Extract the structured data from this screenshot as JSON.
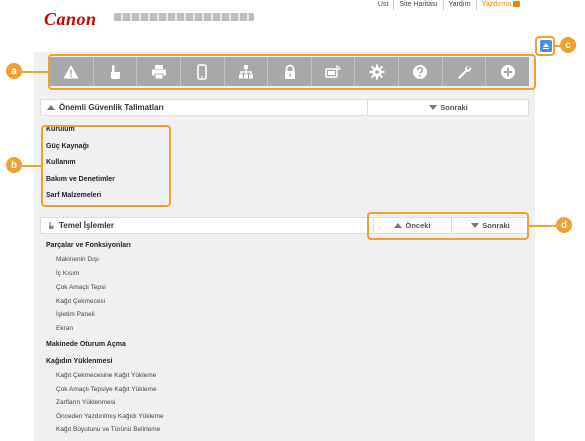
{
  "header": {
    "logo": "Canon",
    "links": [
      "Üst",
      "Site Haritası",
      "Yardım",
      "Yazdırma"
    ]
  },
  "toolbar": {
    "icons": [
      "warning-icon",
      "hand-icon",
      "printer-icon",
      "phone-icon",
      "network-icon",
      "lock-icon",
      "device-icon",
      "gear-icon",
      "help-icon",
      "wrench-icon",
      "plus-icon"
    ]
  },
  "section_safety": {
    "title": "Önemli Güvenlik Talimatları",
    "next": "Sonraki",
    "items": [
      "Kurulum",
      "Güç Kaynağı",
      "Kullanım",
      "Bakım ve Denetimler",
      "Sarf Malzemeleri"
    ]
  },
  "section_basic": {
    "title": "Temel İşlemler",
    "prev": "Önceki",
    "next": "Sonraki"
  },
  "parts": {
    "title": "Parçalar ve Fonksiyonları",
    "items": [
      "Makinenin Dışı",
      "İç Kısım",
      "Çok Amaçlı Tepsi",
      "Kağıt Çekmecesi",
      "İşletim Paneli",
      "Ekran"
    ]
  },
  "login": {
    "title": "Makinede Oturum Açma"
  },
  "loading": {
    "title": "Kağıdın Yüklenmesi",
    "items": [
      "Kağıt Çekmecesine Kağıt Yükleme",
      "Çok Amaçlı Tepsiye Kağıt Yükleme",
      "Zarfların Yüklenmesi",
      "Önceden Yazdırılmış Kağıdı Yükleme",
      "Kağıt Boyutunu ve Türünü Belirleme"
    ]
  },
  "callouts": {
    "a": "a",
    "b": "b",
    "c": "c",
    "d": "d"
  }
}
